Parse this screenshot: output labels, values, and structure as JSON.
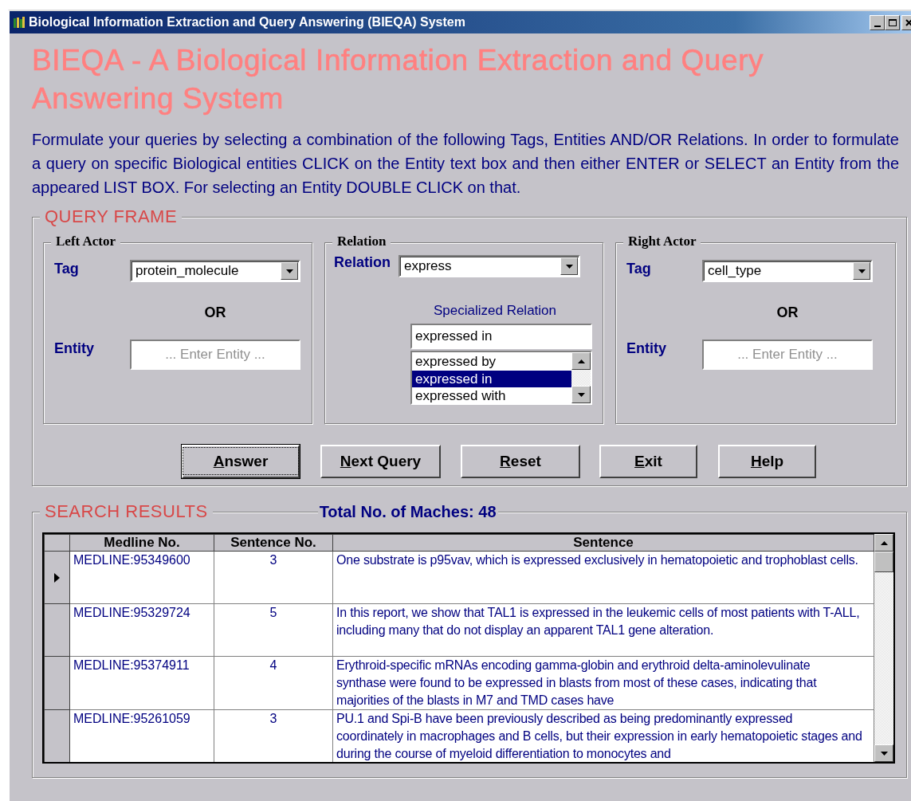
{
  "window": {
    "title": "Biological Information Extraction and Query Answering (BIEQA) System"
  },
  "heading": "BIEQA - A Biological Information Extraction and Query Answering System",
  "instructions": "Formulate your queries by selecting a combination of the following Tags, Entities AND/OR Relations. In order to formulate a query on specific Biological entities CLICK on the Entity text box and then either ENTER or SELECT an Entity from the appeared LIST BOX. For selecting an Entity DOUBLE CLICK on that.",
  "query_frame": {
    "title": "QUERY FRAME",
    "left_actor": {
      "title": "Left Actor",
      "tag_label": "Tag",
      "tag_value": "protein_molecule",
      "or": "OR",
      "entity_label": "Entity",
      "entity_placeholder": "... Enter Entity ..."
    },
    "relation": {
      "title": "Relation",
      "relation_label": "Relation",
      "relation_value": "express",
      "specialized_label": "Specialized Relation",
      "specialized_value": "expressed in",
      "options": [
        {
          "label": "expressed by",
          "selected": false
        },
        {
          "label": "expressed in",
          "selected": true
        },
        {
          "label": "expressed with",
          "selected": false
        }
      ]
    },
    "right_actor": {
      "title": "Right Actor",
      "tag_label": "Tag",
      "tag_value": "cell_type",
      "or": "OR",
      "entity_label": "Entity",
      "entity_placeholder": "... Enter Entity ..."
    },
    "buttons": [
      {
        "label": "Answer",
        "focused": true
      },
      {
        "label": "Next Query",
        "focused": false
      },
      {
        "label": "Reset",
        "focused": false
      },
      {
        "label": "Exit",
        "focused": false
      },
      {
        "label": "Help",
        "focused": false
      }
    ]
  },
  "search_results": {
    "title": "SEARCH RESULTS",
    "total": "Total No. of Maches: 48",
    "table": {
      "columns": [
        "Medline No.",
        "Sentence No.",
        "Sentence"
      ],
      "rows": [
        {
          "current": true,
          "cells": [
            "MEDLINE:95349600",
            "3",
            "One substrate is p95vav, which is expressed exclusively in hematopoietic and trophoblast cells."
          ]
        },
        {
          "current": false,
          "cells": [
            "MEDLINE:95329724",
            "5",
            "In this report, we show that TAL1 is expressed in the leukemic cells of most patients with T-ALL, including many that do not display an apparent TAL1 gene alteration."
          ]
        },
        {
          "current": false,
          "cells": [
            "MEDLINE:95374911",
            "4",
            "Erythroid-specific mRNAs encoding gamma-globin and erythroid delta-aminolevulinate synthase were found to be expressed in blasts from most of these cases, indicating that majorities of the blasts in M7 and TMD cases have"
          ]
        },
        {
          "current": false,
          "cells": [
            "MEDLINE:95261059",
            "3",
            "PU.1 and Spi-B have been previously described as being predominantly expressed coordinately in macrophages and B cells, but their expression in early hematopoietic stages and during the course of myeloid differentiation to monocytes and"
          ]
        }
      ]
    }
  }
}
